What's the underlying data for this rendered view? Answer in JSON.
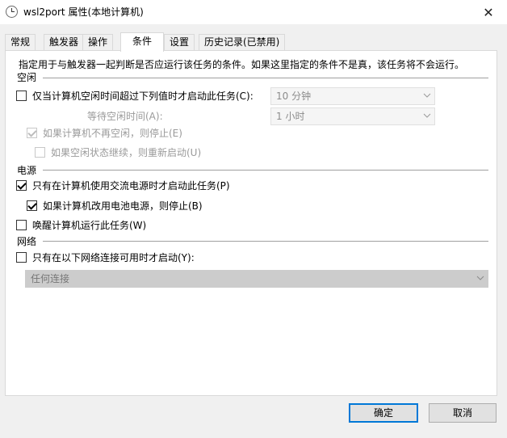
{
  "window": {
    "title": "wsl2port 属性(本地计算机)",
    "close_symbol": "✕"
  },
  "tabs": [
    {
      "label": "常规"
    },
    {
      "label": "触发器"
    },
    {
      "label": "操作"
    },
    {
      "label": "条件"
    },
    {
      "label": "设置"
    },
    {
      "label": "历史记录(已禁用)"
    }
  ],
  "active_tab": "条件",
  "description": "指定用于与触发器一起判断是否应运行该任务的条件。如果这里指定的条件不是真，该任务将不会运行。",
  "idle": {
    "section_title": "空闲",
    "start_if_idle": {
      "label": "仅当计算机空闲时间超过下列值时才启动此任务(C):",
      "checked": false
    },
    "idle_for_value": "10 分钟",
    "wait_label": "等待空闲时间(A):",
    "wait_value": "1 小时",
    "stop_if_not_idle": {
      "label": "如果计算机不再空闲，则停止(E)",
      "checked": true,
      "disabled": true
    },
    "restart_if_idle_resumes": {
      "label": "如果空闲状态继续，则重新启动(U)",
      "checked": false,
      "disabled": true
    }
  },
  "power": {
    "section_title": "电源",
    "ac_power_only": {
      "label": "只有在计算机使用交流电源时才启动此任务(P)",
      "checked": true
    },
    "stop_on_battery": {
      "label": "如果计算机改用电池电源，则停止(B)",
      "checked": true
    },
    "wake_to_run": {
      "label": "唤醒计算机运行此任务(W)",
      "checked": false
    }
  },
  "network": {
    "section_title": "网络",
    "network_available": {
      "label": "只有在以下网络连接可用时才启动(Y):",
      "checked": false
    },
    "connection_value": "任何连接"
  },
  "buttons": {
    "ok": "确定",
    "cancel": "取消"
  },
  "colors": {
    "default_button_border": "#0078d7",
    "section_line": "#a0a0a0"
  }
}
